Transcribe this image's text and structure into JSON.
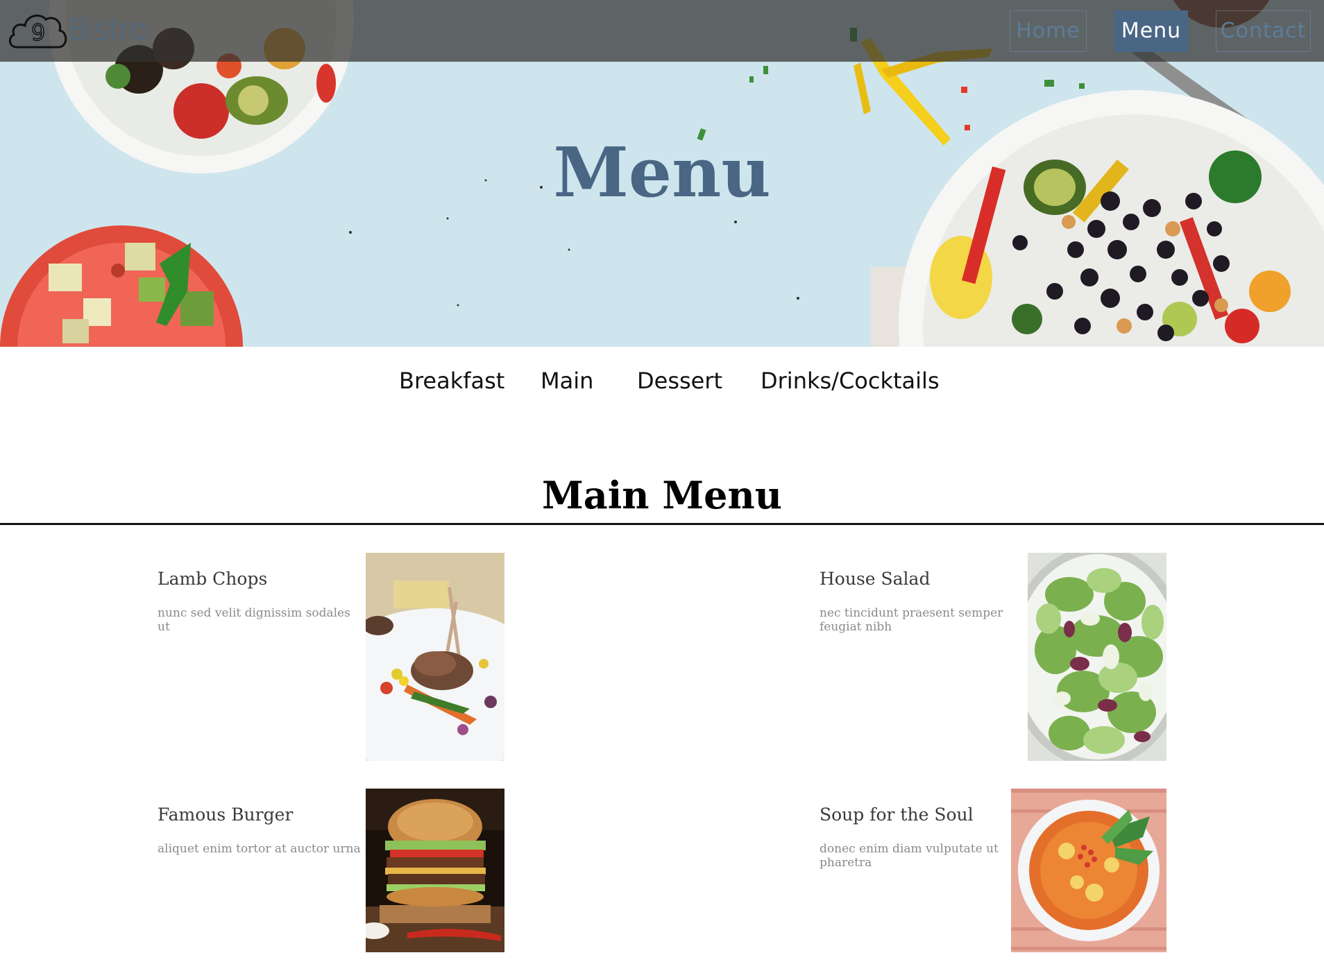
{
  "navbar": {
    "logo_glyph": "9",
    "brand": "Bistro",
    "links": [
      {
        "label": "Home",
        "active": false
      },
      {
        "label": "Menu",
        "active": true
      },
      {
        "label": "Contact",
        "active": false
      }
    ],
    "active_color": "#4a6685"
  },
  "hero": {
    "title": "Menu"
  },
  "categories": [
    "Breakfast",
    "Main",
    "Dessert",
    "Drinks/Cocktails"
  ],
  "main_menu": {
    "title": "Main Menu",
    "items": [
      {
        "name": "Lamb Chops",
        "description": "nunc sed velit dignissim sodales ut",
        "image": "lamb-chops-photo"
      },
      {
        "name": "House Salad",
        "description": "nec tincidunt praesent semper feugiat nibh",
        "image": "house-salad-photo"
      },
      {
        "name": "Famous Burger",
        "description": "aliquet enim tortor at auctor urna",
        "image": "burger-photo"
      },
      {
        "name": "Soup for the Soul",
        "description": "donec enim diam vulputate ut pharetra",
        "image": "soup-photo"
      }
    ]
  }
}
